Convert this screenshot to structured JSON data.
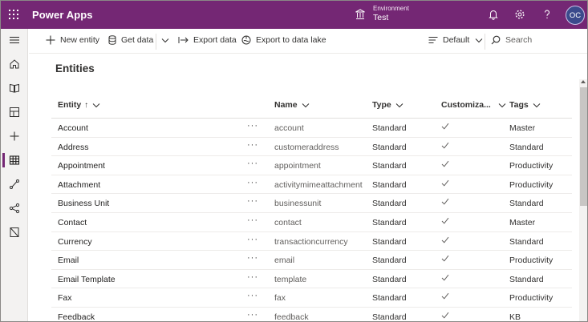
{
  "header": {
    "app_title": "Power Apps",
    "environment_label": "Environment",
    "environment_value": "Test",
    "avatar_initials": "OC",
    "brand_color": "#742774"
  },
  "left_nav": {
    "items": [
      {
        "icon": "hamburger-icon"
      },
      {
        "icon": "home-icon"
      },
      {
        "icon": "learn-book-icon"
      },
      {
        "icon": "apps-icon"
      },
      {
        "icon": "create-plus-icon"
      },
      {
        "icon": "data-table-icon",
        "active": true
      },
      {
        "icon": "flows-icon"
      },
      {
        "icon": "ai-builder-icon"
      },
      {
        "icon": "solutions-icon"
      }
    ]
  },
  "command_bar": {
    "new_entity": "New entity",
    "get_data": "Get data",
    "export_data": "Export data",
    "export_lake": "Export to data lake",
    "view": "Default",
    "search_placeholder": "Search"
  },
  "page": {
    "title": "Entities"
  },
  "table": {
    "columns": {
      "entity": "Entity",
      "name": "Name",
      "type": "Type",
      "customizable": "Customiza...",
      "tags": "Tags"
    },
    "sort_indicator": "↑",
    "more_label": "···",
    "rows": [
      {
        "entity": "Account",
        "name": "account",
        "type": "Standard",
        "customizable": true,
        "tags": "Master"
      },
      {
        "entity": "Address",
        "name": "customeraddress",
        "type": "Standard",
        "customizable": true,
        "tags": "Standard"
      },
      {
        "entity": "Appointment",
        "name": "appointment",
        "type": "Standard",
        "customizable": true,
        "tags": "Productivity"
      },
      {
        "entity": "Attachment",
        "name": "activitymimeattachment",
        "type": "Standard",
        "customizable": true,
        "tags": "Productivity"
      },
      {
        "entity": "Business Unit",
        "name": "businessunit",
        "type": "Standard",
        "customizable": true,
        "tags": "Standard"
      },
      {
        "entity": "Contact",
        "name": "contact",
        "type": "Standard",
        "customizable": true,
        "tags": "Master"
      },
      {
        "entity": "Currency",
        "name": "transactioncurrency",
        "type": "Standard",
        "customizable": true,
        "tags": "Standard"
      },
      {
        "entity": "Email",
        "name": "email",
        "type": "Standard",
        "customizable": true,
        "tags": "Productivity"
      },
      {
        "entity": "Email Template",
        "name": "template",
        "type": "Standard",
        "customizable": true,
        "tags": "Standard"
      },
      {
        "entity": "Fax",
        "name": "fax",
        "type": "Standard",
        "customizable": true,
        "tags": "Productivity"
      },
      {
        "entity": "Feedback",
        "name": "feedback",
        "type": "Standard",
        "customizable": true,
        "tags": "KB"
      }
    ]
  }
}
